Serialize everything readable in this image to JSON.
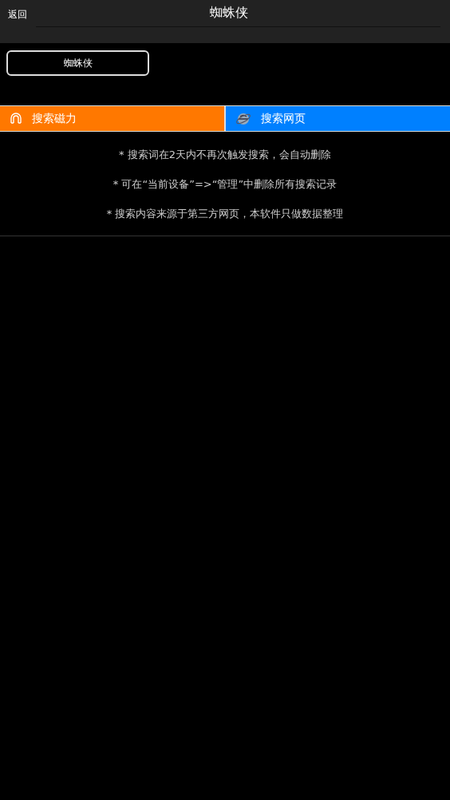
{
  "nav_bar": {
    "back": "返回",
    "title": "蜘蛛侠"
  },
  "keywords": [
    "蜘蛛侠"
  ],
  "search_buttons": [
    {
      "kind": "magnet",
      "label": "搜索磁力",
      "color": "#ff7800"
    },
    {
      "kind": "web",
      "label": "搜索网页",
      "color": "#0080ff"
    }
  ],
  "notes": [
    "* 搜索词在2天内不再次触发搜索，会自动删除",
    "* 可在“当前设备”=>“管理”中删除所有搜索记录",
    "* 搜索内容来源于第三方网页，本软件只做数据整理"
  ]
}
